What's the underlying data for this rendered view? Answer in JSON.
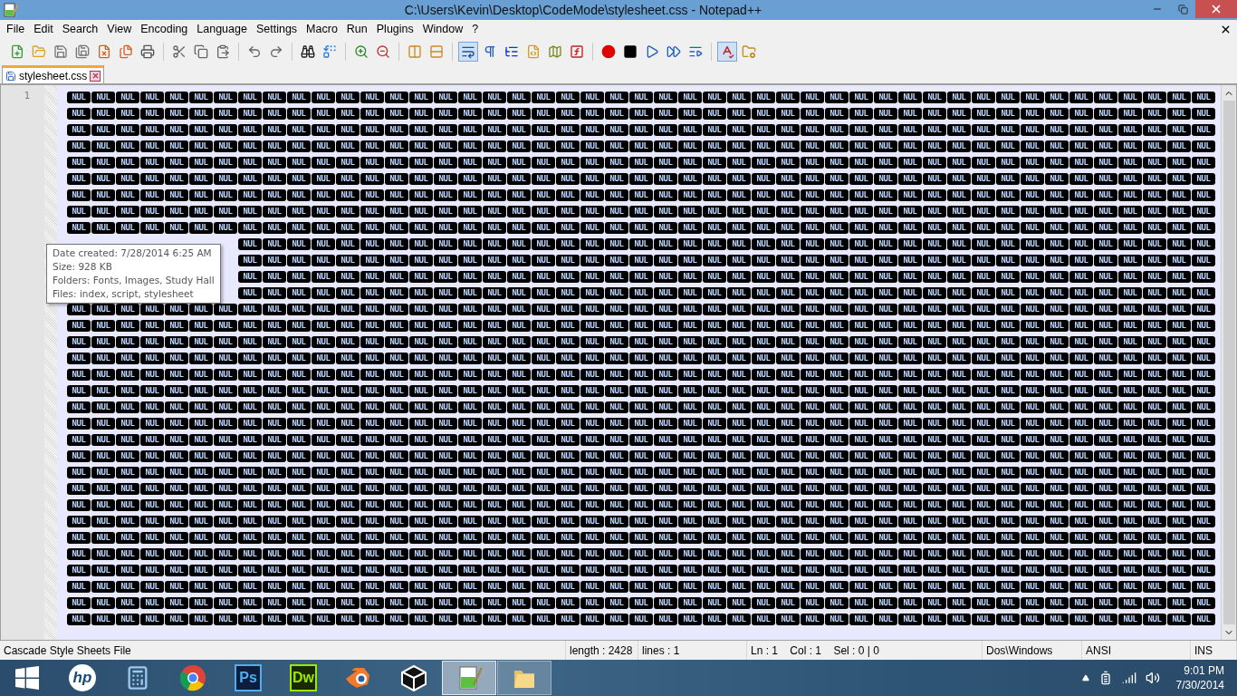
{
  "window": {
    "title": "C:\\Users\\Kevin\\Desktop\\CodeMode\\stylesheet.css - Notepad++"
  },
  "menu": [
    "File",
    "Edit",
    "Search",
    "View",
    "Encoding",
    "Language",
    "Settings",
    "Macro",
    "Run",
    "Plugins",
    "Window",
    "?"
  ],
  "toolbar": [
    [
      {
        "kind": "new",
        "selected": false
      },
      {
        "kind": "open",
        "selected": false
      },
      {
        "kind": "save",
        "selected": false
      },
      {
        "kind": "save-all",
        "selected": false
      },
      {
        "kind": "close",
        "selected": false
      },
      {
        "kind": "close-all",
        "selected": false
      },
      {
        "kind": "print",
        "selected": false
      }
    ],
    [
      {
        "kind": "cut",
        "selected": false
      },
      {
        "kind": "copy",
        "selected": false
      },
      {
        "kind": "paste",
        "selected": false
      }
    ],
    [
      {
        "kind": "undo",
        "selected": false
      },
      {
        "kind": "redo",
        "selected": false
      }
    ],
    [
      {
        "kind": "find",
        "selected": false
      },
      {
        "kind": "replace",
        "selected": false
      }
    ],
    [
      {
        "kind": "zoom-in",
        "selected": false
      },
      {
        "kind": "zoom-out",
        "selected": false
      }
    ],
    [
      {
        "kind": "sync-vertical",
        "selected": false
      },
      {
        "kind": "sync-horizontal",
        "selected": false
      }
    ],
    [
      {
        "kind": "word-wrap",
        "selected": true
      },
      {
        "kind": "show-all",
        "selected": false
      },
      {
        "kind": "indent-guide",
        "selected": false
      },
      {
        "kind": "language",
        "selected": false
      },
      {
        "kind": "doc-map",
        "selected": false
      },
      {
        "kind": "function-list",
        "selected": false
      }
    ],
    [
      {
        "kind": "record",
        "selected": false
      },
      {
        "kind": "stop",
        "selected": false
      },
      {
        "kind": "play",
        "selected": false
      },
      {
        "kind": "play-multiple",
        "selected": false
      },
      {
        "kind": "save-macro",
        "selected": false
      }
    ],
    [
      {
        "kind": "spellcheck",
        "selected": true
      },
      {
        "kind": "workspace",
        "selected": false
      }
    ]
  ],
  "tabs": [
    {
      "label": "stylesheet.css",
      "selected": true
    }
  ],
  "editor": {
    "line_numbers": [
      "1"
    ],
    "rows": [
      [
        "NUL",
        "NUL",
        "NUL",
        "NUL",
        "NUL",
        "NUL",
        "NUL",
        "NUL",
        "NUL",
        "NUL",
        "NUL",
        "NUL",
        "NUL",
        "NUL",
        "NUL",
        "NUL",
        "NUL",
        "NUL",
        "NUL",
        "NUL",
        "NUL",
        "NUL",
        "NUL",
        "NUL",
        "NUL",
        "NUL",
        "NUL",
        "NUL",
        "NUL",
        "NUL",
        "NUL",
        "NUL",
        "NUL",
        "NUL",
        "NUL",
        "NUL",
        "NUL",
        "NUL",
        "NUL",
        "NUL",
        "NUL",
        "NUL",
        "NUL",
        "NUL",
        "NUL",
        "NUL",
        "NUL"
      ],
      [
        "NUL",
        "NUL",
        "NUL",
        "NUL",
        "NUL",
        "NUL",
        "NUL",
        "NUL",
        "NUL",
        "NUL",
        "NUL",
        "NUL",
        "NUL",
        "NUL",
        "NUL",
        "NUL",
        "NUL",
        "NUL",
        "NUL",
        "NUL",
        "NUL",
        "NUL",
        "NUL",
        "NUL",
        "NUL",
        "NUL",
        "NUL",
        "NUL",
        "NUL",
        "NUL",
        "NUL",
        "NUL",
        "NUL",
        "NUL",
        "NUL",
        "NUL",
        "NUL",
        "NUL",
        "NUL",
        "NUL",
        "NUL",
        "NUL",
        "NUL",
        "NUL",
        "NUL",
        "NUL",
        "NUL"
      ],
      [
        "NUL",
        "NUL",
        "NUL",
        "NUL",
        "NUL",
        "NUL",
        "NUL",
        "NUL",
        "NUL",
        "NUL",
        "NUL",
        "NUL",
        "NUL",
        "NUL",
        "NUL",
        "NUL",
        "NUL",
        "NUL",
        "NUL",
        "NUL",
        "NUL",
        "NUL",
        "NUL",
        "NUL",
        "NUL",
        "NUL",
        "NUL",
        "NUL",
        "NUL",
        "NUL",
        "NUL",
        "NUL",
        "NUL",
        "NUL",
        "NUL",
        "NUL",
        "NUL",
        "NUL",
        "NUL",
        "NUL",
        "NUL",
        "NUL",
        "NUL",
        "NUL",
        "NUL",
        "NUL",
        "NUL"
      ],
      [
        "NUL",
        "NUL",
        "NUL",
        "NUL",
        "NUL",
        "NUL",
        "NUL",
        "NUL",
        "NUL",
        "NUL",
        "NUL",
        "NUL",
        "NUL",
        "NUL",
        "NUL",
        "NUL",
        "NUL",
        "NUL",
        "NUL",
        "NUL",
        "NUL",
        "NUL",
        "NUL",
        "NUL",
        "NUL",
        "NUL",
        "NUL",
        "NUL",
        "NUL",
        "NUL",
        "NUL",
        "NUL",
        "NUL",
        "NUL",
        "NUL",
        "NUL",
        "NUL",
        "NUL",
        "NUL",
        "NUL",
        "NUL",
        "NUL",
        "NUL",
        "NUL",
        "NUL",
        "NUL",
        "NUL"
      ],
      [
        "NUL",
        "NUL",
        "NUL",
        "NUL",
        "NUL",
        "NUL",
        "NUL",
        "NUL",
        "NUL",
        "NUL",
        "NUL",
        "NUL",
        "NUL",
        "NUL",
        "NUL",
        "NUL",
        "NUL",
        "NUL",
        "NUL",
        "NUL",
        "NUL",
        "NUL",
        "NUL",
        "NUL",
        "NUL",
        "NUL",
        "NUL",
        "NUL",
        "NUL",
        "NUL",
        "NUL",
        "NUL",
        "NUL",
        "NUL",
        "NUL",
        "NUL",
        "NUL",
        "NUL",
        "NUL",
        "NUL",
        "NUL",
        "NUL",
        "NUL",
        "NUL",
        "NUL",
        "NUL",
        "NUL"
      ],
      [
        "NUL",
        "NUL",
        "NUL",
        "NUL",
        "NUL",
        "NUL",
        "NUL",
        "NUL",
        "NUL",
        "NUL",
        "NUL",
        "NUL",
        "NUL",
        "NUL",
        "NUL",
        "NUL",
        "NUL",
        "NUL",
        "NUL",
        "NUL",
        "NUL",
        "NUL",
        "NUL",
        "NUL",
        "NUL",
        "NUL",
        "NUL",
        "NUL",
        "NUL",
        "NUL",
        "NUL",
        "NUL",
        "NUL",
        "NUL",
        "NUL",
        "NUL",
        "NUL",
        "NUL",
        "NUL",
        "NUL",
        "NUL",
        "NUL",
        "NUL",
        "NUL",
        "NUL",
        "NUL",
        "NUL"
      ],
      [
        "NUL",
        "NUL",
        "NUL",
        "NUL",
        "NUL",
        "NUL",
        "NUL",
        "NUL",
        "NUL",
        "NUL",
        "NUL",
        "NUL",
        "NUL",
        "NUL",
        "NUL",
        "NUL",
        "NUL",
        "NUL",
        "NUL",
        "NUL",
        "NUL",
        "NUL",
        "NUL",
        "NUL",
        "NUL",
        "NUL",
        "NUL",
        "NUL",
        "NUL",
        "NUL",
        "NUL",
        "NUL",
        "NUL",
        "NUL",
        "NUL",
        "NUL",
        "NUL",
        "NUL",
        "NUL",
        "NUL",
        "NUL",
        "NUL",
        "NUL",
        "NUL",
        "NUL",
        "NUL",
        "NUL"
      ],
      [
        "NUL",
        "NUL",
        "NUL",
        "NUL",
        "NUL",
        "NUL",
        "NUL",
        "NUL",
        "NUL",
        "NUL",
        "NUL",
        "NUL",
        "NUL",
        "NUL",
        "NUL",
        "NUL",
        "NUL",
        "NUL",
        "NUL",
        "NUL",
        "NUL",
        "NUL",
        "NUL",
        "NUL",
        "NUL",
        "NUL",
        "NUL",
        "NUL",
        "NUL",
        "NUL",
        "NUL",
        "NUL",
        "NUL",
        "NUL",
        "NUL",
        "NUL",
        "NUL",
        "NUL",
        "NUL",
        "NUL",
        "NUL",
        "NUL",
        "NUL",
        "NUL",
        "NUL",
        "NUL",
        "NUL"
      ],
      [
        "NUL",
        "NUL",
        "NUL",
        "NUL",
        "NUL",
        "NUL",
        "NUL",
        "NUL",
        "NUL",
        "NUL",
        "NUL",
        "NUL",
        "NUL",
        "NUL",
        "NUL",
        "NUL",
        "NUL",
        "NUL",
        "NUL",
        "NUL",
        "NUL",
        "NUL",
        "NUL",
        "NUL",
        "NUL",
        "NUL",
        "NUL",
        "NUL",
        "NUL",
        "NUL",
        "NUL",
        "NUL",
        "NUL",
        "NUL",
        "NUL",
        "NUL",
        "NUL",
        "NUL",
        "NUL",
        "NUL",
        "NUL",
        "NUL",
        "NUL",
        "NUL",
        "NUL",
        "NUL",
        "NUL"
      ],
      [
        "NUL",
        "NUL",
        "NUL",
        "NUL",
        "NUL",
        "NUL",
        "NUL",
        "NUL",
        "NUL",
        "NUL",
        "NUL",
        "NUL",
        "NUL",
        "NUL",
        "NUL",
        "NUL",
        "NUL",
        "NUL",
        "NUL",
        "NUL",
        "NUL",
        "NUL",
        "NUL",
        "NUL",
        "NUL",
        "NUL",
        "NUL",
        "NUL",
        "NUL",
        "NUL",
        "NUL",
        "NUL",
        "NUL",
        "NUL",
        "NUL",
        "NUL",
        "NUL",
        "NUL",
        "NUL",
        "NUL"
      ],
      [
        "NUL",
        "NUL",
        "NUL",
        "NUL",
        "NUL",
        "NUL",
        "NUL",
        "NUL",
        "NUL",
        "NUL",
        "NUL",
        "NUL",
        "NUL",
        "NUL",
        "NUL",
        "NUL",
        "NUL",
        "NUL",
        "NUL",
        "NUL",
        "NUL",
        "NUL",
        "NUL",
        "NUL",
        "NUL",
        "NUL",
        "NUL",
        "NUL",
        "NUL",
        "NUL",
        "NUL",
        "NUL",
        "NUL",
        "NUL",
        "NUL",
        "NUL",
        "NUL",
        "NUL",
        "NUL",
        "NUL"
      ],
      [
        "NUL",
        "NUL",
        "NUL",
        "NUL",
        "NUL",
        "NUL",
        "NUL",
        "NUL",
        "NUL",
        "NUL",
        "NUL",
        "NUL",
        "NUL",
        "NUL",
        "NUL",
        "NUL",
        "NUL",
        "NUL",
        "NUL",
        "NUL",
        "NUL",
        "NUL",
        "NUL",
        "NUL",
        "NUL",
        "NUL",
        "NUL",
        "NUL",
        "NUL",
        "NUL",
        "NUL",
        "NUL",
        "NUL",
        "NUL",
        "NUL",
        "NUL",
        "NUL",
        "NUL",
        "NUL",
        "NUL"
      ],
      [
        "NUL",
        "NUL",
        "NUL",
        "NUL",
        "NUL",
        "NUL",
        "NUL",
        "NUL",
        "NUL",
        "NUL",
        "NUL",
        "NUL",
        "NUL",
        "NUL",
        "NUL",
        "NUL",
        "NUL",
        "NUL",
        "NUL",
        "NUL",
        "NUL",
        "NUL",
        "NUL",
        "NUL",
        "NUL",
        "NUL",
        "NUL",
        "NUL",
        "NUL",
        "NUL",
        "NUL",
        "NUL",
        "NUL",
        "NUL",
        "NUL",
        "NUL",
        "NUL",
        "NUL",
        "NUL",
        "NUL"
      ],
      [
        "NUL",
        "NUL",
        "NUL",
        "NUL",
        "NUL",
        "NUL",
        "NUL",
        "NUL",
        "NUL",
        "NUL",
        "NUL",
        "NUL",
        "NUL",
        "NUL",
        "NUL",
        "NUL",
        "NUL",
        "NUL",
        "NUL",
        "NUL",
        "NUL",
        "NUL",
        "NUL",
        "NUL",
        "NUL",
        "NUL",
        "NUL",
        "NUL",
        "NUL",
        "NUL",
        "NUL",
        "NUL",
        "NUL",
        "NUL",
        "NUL",
        "NUL",
        "NUL",
        "NUL",
        "NUL",
        "NUL",
        "NUL",
        "NUL",
        "NUL",
        "NUL",
        "NUL",
        "NUL",
        "NUL"
      ],
      [
        "NUL",
        "NUL",
        "NUL",
        "NUL",
        "NUL",
        "NUL",
        "NUL",
        "NUL",
        "NUL",
        "NUL",
        "NUL",
        "NUL",
        "NUL",
        "NUL",
        "NUL",
        "NUL",
        "NUL",
        "NUL",
        "NUL",
        "NUL",
        "NUL",
        "NUL",
        "NUL",
        "NUL",
        "NUL",
        "NUL",
        "NUL",
        "NUL",
        "NUL",
        "NUL",
        "NUL",
        "NUL",
        "NUL",
        "NUL",
        "NUL",
        "NUL",
        "NUL",
        "NUL",
        "NUL",
        "NUL",
        "NUL",
        "NUL",
        "NUL",
        "NUL",
        "NUL",
        "NUL",
        "NUL"
      ],
      [
        "NUL",
        "NUL",
        "NUL",
        "NUL",
        "NUL",
        "NUL",
        "NUL",
        "NUL",
        "NUL",
        "NUL",
        "NUL",
        "NUL",
        "NUL",
        "NUL",
        "NUL",
        "NUL",
        "NUL",
        "NUL",
        "NUL",
        "NUL",
        "NUL",
        "NUL",
        "NUL",
        "NUL",
        "NUL",
        "NUL",
        "NUL",
        "NUL",
        "NUL",
        "NUL",
        "NUL",
        "NUL",
        "NUL",
        "NUL",
        "NUL",
        "NUL",
        "NUL",
        "NUL",
        "NUL",
        "NUL",
        "NUL",
        "NUL",
        "NUL",
        "NUL",
        "NUL",
        "NUL",
        "NUL"
      ],
      [
        "NUL",
        "NUL",
        "NUL",
        "NUL",
        "NUL",
        "NUL",
        "NUL",
        "NUL",
        "NUL",
        "NUL",
        "NUL",
        "NUL",
        "NUL",
        "NUL",
        "NUL",
        "NUL",
        "NUL",
        "NUL",
        "NUL",
        "NUL",
        "NUL",
        "NUL",
        "NUL",
        "NUL",
        "NUL",
        "NUL",
        "NUL",
        "NUL",
        "NUL",
        "NUL",
        "NUL",
        "NUL",
        "NUL",
        "NUL",
        "NUL",
        "NUL",
        "NUL",
        "NUL",
        "NUL",
        "NUL",
        "NUL",
        "NUL",
        "NUL",
        "NUL",
        "NUL",
        "NUL",
        "NUL"
      ],
      [
        "NUL",
        "NUL",
        "NUL",
        "NUL",
        "NUL",
        "NUL",
        "NUL",
        "NUL",
        "NUL",
        "NUL",
        "NUL",
        "NUL",
        "NUL",
        "NUL",
        "NUL",
        "NUL",
        "NUL",
        "NUL",
        "NUL",
        "NUL",
        "NUL",
        "NUL",
        "NUL",
        "NUL",
        "NUL",
        "NUL",
        "NUL",
        "NUL",
        "NUL",
        "NUL",
        "NUL",
        "NUL",
        "NUL",
        "NUL",
        "NUL",
        "NUL",
        "NUL",
        "NUL",
        "NUL",
        "NUL",
        "NUL",
        "NUL",
        "NUL",
        "NUL",
        "NUL",
        "NUL",
        "NUL"
      ],
      [
        "NUL",
        "NUL",
        "NUL",
        "NUL",
        "NUL",
        "NUL",
        "NUL",
        "NUL",
        "NUL",
        "NUL",
        "NUL",
        "NUL",
        "NUL",
        "NUL",
        "NUL",
        "NUL",
        "NUL",
        "NUL",
        "NUL",
        "NUL",
        "NUL",
        "NUL",
        "NUL",
        "NUL",
        "NUL",
        "NUL",
        "NUL",
        "NUL",
        "NUL",
        "NUL",
        "NUL",
        "NUL",
        "NUL",
        "NUL",
        "NUL",
        "NUL",
        "NUL",
        "NUL",
        "NUL",
        "NUL",
        "NUL",
        "NUL",
        "NUL",
        "NUL",
        "NUL",
        "NUL",
        "NUL"
      ],
      [
        "NUL",
        "NUL",
        "NUL",
        "NUL",
        "NUL",
        "NUL",
        "NUL",
        "NUL",
        "NUL",
        "NUL",
        "NUL",
        "NUL",
        "NUL",
        "NUL",
        "NUL",
        "NUL",
        "NUL",
        "NUL",
        "NUL",
        "NUL",
        "NUL",
        "NUL",
        "NUL",
        "NUL",
        "NUL",
        "NUL",
        "NUL",
        "NUL",
        "NUL",
        "NUL",
        "NUL",
        "NUL",
        "NUL",
        "NUL",
        "NUL",
        "NUL",
        "NUL",
        "NUL",
        "NUL",
        "NUL",
        "NUL",
        "NUL",
        "NUL",
        "NUL",
        "NUL",
        "NUL",
        "NUL"
      ],
      [
        "NUL",
        "NUL",
        "NUL",
        "NUL",
        "NUL",
        "NUL",
        "NUL",
        "NUL",
        "NUL",
        "NUL",
        "NUL",
        "NUL",
        "NUL",
        "NUL",
        "NUL",
        "NUL",
        "NUL",
        "NUL",
        "NUL",
        "NUL",
        "NUL",
        "NUL",
        "NUL",
        "NUL",
        "NUL",
        "NUL",
        "NUL",
        "NUL",
        "NUL",
        "NUL",
        "NUL",
        "NUL",
        "NUL",
        "NUL",
        "NUL",
        "NUL",
        "NUL",
        "NUL",
        "NUL",
        "NUL",
        "NUL",
        "NUL",
        "NUL",
        "NUL",
        "NUL",
        "NUL",
        "NUL"
      ],
      [
        "NUL",
        "NUL",
        "NUL",
        "NUL",
        "NUL",
        "NUL",
        "NUL",
        "NUL",
        "NUL",
        "NUL",
        "NUL",
        "NUL",
        "NUL",
        "NUL",
        "NUL",
        "NUL",
        "NUL",
        "NUL",
        "NUL",
        "NUL",
        "NUL",
        "NUL",
        "NUL",
        "NUL",
        "NUL",
        "NUL",
        "NUL",
        "NUL",
        "NUL",
        "NUL",
        "NUL",
        "NUL",
        "NUL",
        "NUL",
        "NUL",
        "NUL",
        "NUL",
        "NUL",
        "NUL",
        "NUL",
        "NUL",
        "NUL",
        "NUL",
        "NUL",
        "NUL",
        "NUL",
        "NUL"
      ],
      [
        "NUL",
        "NUL",
        "NUL",
        "NUL",
        "NUL",
        "NUL",
        "NUL",
        "NUL",
        "NUL",
        "NUL",
        "NUL",
        "NUL",
        "NUL",
        "NUL",
        "NUL",
        "NUL",
        "NUL",
        "NUL",
        "NUL",
        "NUL",
        "NUL",
        "NUL",
        "NUL",
        "NUL",
        "NUL",
        "NUL",
        "NUL",
        "NUL",
        "NUL",
        "NUL",
        "NUL",
        "NUL",
        "NUL",
        "NUL",
        "NUL",
        "NUL",
        "NUL",
        "NUL",
        "NUL",
        "NUL",
        "NUL",
        "NUL",
        "NUL",
        "NUL",
        "NUL",
        "NUL",
        "NUL"
      ],
      [
        "NUL",
        "NUL",
        "NUL",
        "NUL",
        "NUL",
        "NUL",
        "NUL",
        "NUL",
        "NUL",
        "NUL",
        "NUL",
        "NUL",
        "NUL",
        "NUL",
        "NUL",
        "NUL",
        "NUL",
        "NUL",
        "NUL",
        "NUL",
        "NUL",
        "NUL",
        "NUL",
        "NUL",
        "NUL",
        "NUL",
        "NUL",
        "NUL",
        "NUL",
        "NUL",
        "NUL",
        "NUL",
        "NUL",
        "NUL",
        "NUL",
        "NUL",
        "NUL",
        "NUL",
        "NUL",
        "NUL",
        "NUL",
        "NUL",
        "NUL",
        "NUL",
        "NUL",
        "NUL",
        "NUL"
      ],
      [
        "NUL",
        "NUL",
        "NUL",
        "NUL",
        "NUL",
        "NUL",
        "NUL",
        "NUL",
        "NUL",
        "NUL",
        "NUL",
        "NUL",
        "NUL",
        "NUL",
        "NUL",
        "NUL",
        "NUL",
        "NUL",
        "NUL",
        "NUL",
        "NUL",
        "NUL",
        "NUL",
        "NUL",
        "NUL",
        "NUL",
        "NUL",
        "NUL",
        "NUL",
        "NUL",
        "NUL",
        "NUL",
        "NUL",
        "NUL",
        "NUL",
        "NUL",
        "NUL",
        "NUL",
        "NUL",
        "NUL",
        "NUL",
        "NUL",
        "NUL",
        "NUL",
        "NUL",
        "NUL",
        "NUL"
      ],
      [
        "NUL",
        "NUL",
        "NUL",
        "NUL",
        "NUL",
        "NUL",
        "NUL",
        "NUL",
        "NUL",
        "NUL",
        "NUL",
        "NUL",
        "NUL",
        "NUL",
        "NUL",
        "NUL",
        "NUL",
        "NUL",
        "NUL",
        "NUL",
        "NUL",
        "NUL",
        "NUL",
        "NUL",
        "NUL",
        "NUL",
        "NUL",
        "NUL",
        "NUL",
        "NUL",
        "NUL",
        "NUL",
        "NUL",
        "NUL",
        "NUL",
        "NUL",
        "NUL",
        "NUL",
        "NUL",
        "NUL",
        "NUL",
        "NUL",
        "NUL",
        "NUL",
        "NUL",
        "NUL",
        "NUL"
      ],
      [
        "NUL",
        "NUL",
        "NUL",
        "NUL",
        "NUL",
        "NUL",
        "NUL",
        "NUL",
        "NUL",
        "NUL",
        "NUL",
        "NUL",
        "NUL",
        "NUL",
        "NUL",
        "NUL",
        "NUL",
        "NUL",
        "NUL",
        "NUL",
        "NUL",
        "NUL",
        "NUL",
        "NUL",
        "NUL",
        "NUL",
        "NUL",
        "NUL",
        "NUL",
        "NUL",
        "NUL",
        "NUL",
        "NUL",
        "NUL",
        "NUL",
        "NUL",
        "NUL",
        "NUL",
        "NUL",
        "NUL",
        "NUL",
        "NUL",
        "NUL",
        "NUL",
        "NUL",
        "NUL",
        "NUL"
      ],
      [
        "NUL",
        "NUL",
        "NUL",
        "NUL",
        "NUL",
        "NUL",
        "NUL",
        "NUL",
        "NUL",
        "NUL",
        "NUL",
        "NUL",
        "NUL",
        "NUL",
        "NUL",
        "NUL",
        "NUL",
        "NUL",
        "NUL",
        "NUL",
        "NUL",
        "NUL",
        "NUL",
        "NUL",
        "NUL",
        "NUL",
        "NUL",
        "NUL",
        "NUL",
        "NUL",
        "NUL",
        "NUL",
        "NUL",
        "NUL",
        "NUL",
        "NUL",
        "NUL",
        "NUL",
        "NUL",
        "NUL",
        "NUL",
        "NUL",
        "NUL",
        "NUL",
        "NUL",
        "NUL",
        "NUL"
      ],
      [
        "NUL",
        "NUL",
        "NUL",
        "NUL",
        "NUL",
        "NUL",
        "NUL",
        "NUL",
        "NUL",
        "NUL",
        "NUL",
        "NUL",
        "NUL",
        "NUL",
        "NUL",
        "NUL",
        "NUL",
        "NUL",
        "NUL",
        "NUL",
        "NUL",
        "NUL",
        "NUL",
        "NUL",
        "NUL",
        "NUL",
        "NUL",
        "NUL",
        "NUL",
        "NUL",
        "NUL",
        "NUL",
        "NUL",
        "NUL",
        "NUL",
        "NUL",
        "NUL",
        "NUL",
        "NUL",
        "NUL",
        "NUL",
        "NUL",
        "NUL",
        "NUL",
        "NUL",
        "NUL",
        "NUL"
      ],
      [
        "NUL",
        "NUL",
        "NUL",
        "NUL",
        "NUL",
        "NUL",
        "NUL",
        "NUL",
        "NUL",
        "NUL",
        "NUL",
        "NUL",
        "NUL",
        "NUL",
        "NUL",
        "NUL",
        "NUL",
        "NUL",
        "NUL",
        "NUL",
        "NUL",
        "NUL",
        "NUL",
        "NUL",
        "NUL",
        "NUL",
        "NUL",
        "NUL",
        "NUL",
        "NUL",
        "NUL",
        "NUL",
        "NUL",
        "NUL",
        "NUL",
        "NUL",
        "NUL",
        "NUL",
        "NUL",
        "NUL",
        "NUL",
        "NUL",
        "NUL",
        "NUL",
        "NUL",
        "NUL",
        "NUL"
      ],
      [
        "NUL",
        "NUL",
        "NUL",
        "NUL",
        "NUL",
        "NUL",
        "NUL",
        "NUL",
        "NUL",
        "NUL",
        "NUL",
        "NUL",
        "NUL",
        "NUL",
        "NUL",
        "NUL",
        "NUL",
        "NUL",
        "NUL",
        "NUL",
        "NUL",
        "NUL",
        "NUL",
        "NUL",
        "NUL",
        "NUL",
        "NUL",
        "NUL",
        "NUL",
        "NUL",
        "NUL",
        "NUL",
        "NUL",
        "NUL",
        "NUL",
        "NUL",
        "NUL",
        "NUL",
        "NUL",
        "NUL",
        "NUL",
        "NUL",
        "NUL",
        "NUL",
        "NUL",
        "NUL",
        "NUL"
      ],
      [
        "NUL",
        "NUL",
        "NUL",
        "NUL",
        "NUL",
        "NUL",
        "NUL",
        "NUL",
        "NUL",
        "NUL",
        "NUL",
        "NUL",
        "NUL",
        "NUL",
        "NUL",
        "NUL",
        "NUL",
        "NUL",
        "NUL",
        "NUL",
        "NUL",
        "NUL",
        "NUL",
        "NUL",
        "NUL",
        "NUL",
        "NUL",
        "NUL",
        "NUL",
        "NUL",
        "NUL",
        "NUL",
        "NUL",
        "NUL",
        "NUL",
        "NUL",
        "NUL",
        "NUL",
        "NUL",
        "NUL",
        "NUL",
        "NUL",
        "NUL",
        "NUL",
        "NUL",
        "NUL",
        "NUL"
      ],
      [
        "NUL",
        "NUL",
        "NUL",
        "NUL",
        "NUL",
        "NUL",
        "NUL",
        "NUL",
        "NUL",
        "NUL",
        "NUL",
        "NUL",
        "NUL",
        "NUL",
        "NUL",
        "NUL",
        "NUL",
        "NUL",
        "NUL",
        "NUL",
        "NUL",
        "NUL",
        "NUL",
        "NUL",
        "NUL",
        "NUL",
        "NUL",
        "NUL",
        "NUL",
        "NUL",
        "NUL",
        "NUL",
        "NUL",
        "NUL",
        "NUL",
        "NUL",
        "NUL",
        "NUL",
        "NUL",
        "NUL",
        "NUL",
        "NUL",
        "NUL",
        "NUL",
        "NUL",
        "NUL",
        "NUL"
      ]
    ]
  },
  "tooltip": [
    "Date created: 7/28/2014 6:25 AM",
    "Size: 928 KB",
    "Folders: Fonts, Images, Study Hall",
    "Files: index, script, stylesheet"
  ],
  "status_bar": [
    "Cascade Style Sheets File",
    "length : 2428",
    "lines : 1",
    "Ln : 1    Col : 1    Sel : 0 | 0",
    "Dos\\Windows",
    "ANSI",
    "INS"
  ],
  "taskbar": {
    "items": [
      {
        "kind": "start",
        "selected": false,
        "running": false
      },
      {
        "kind": "hp",
        "label": "hp",
        "selected": false,
        "running": false
      },
      {
        "kind": "calculator",
        "selected": false,
        "running": false
      },
      {
        "kind": "browser",
        "selected": false,
        "running": false
      },
      {
        "kind": "ps",
        "label": "Ps",
        "selected": false,
        "running": false
      },
      {
        "kind": "dw",
        "label": "Dw",
        "selected": false,
        "running": false
      },
      {
        "kind": "blender",
        "selected": false,
        "running": false
      },
      {
        "kind": "unity",
        "selected": false,
        "running": false
      },
      {
        "kind": "notepad",
        "selected": true,
        "running": true
      },
      {
        "kind": "folder",
        "selected": false,
        "running": true
      }
    ],
    "time": "9:01 PM",
    "date": "7/30/2014"
  }
}
